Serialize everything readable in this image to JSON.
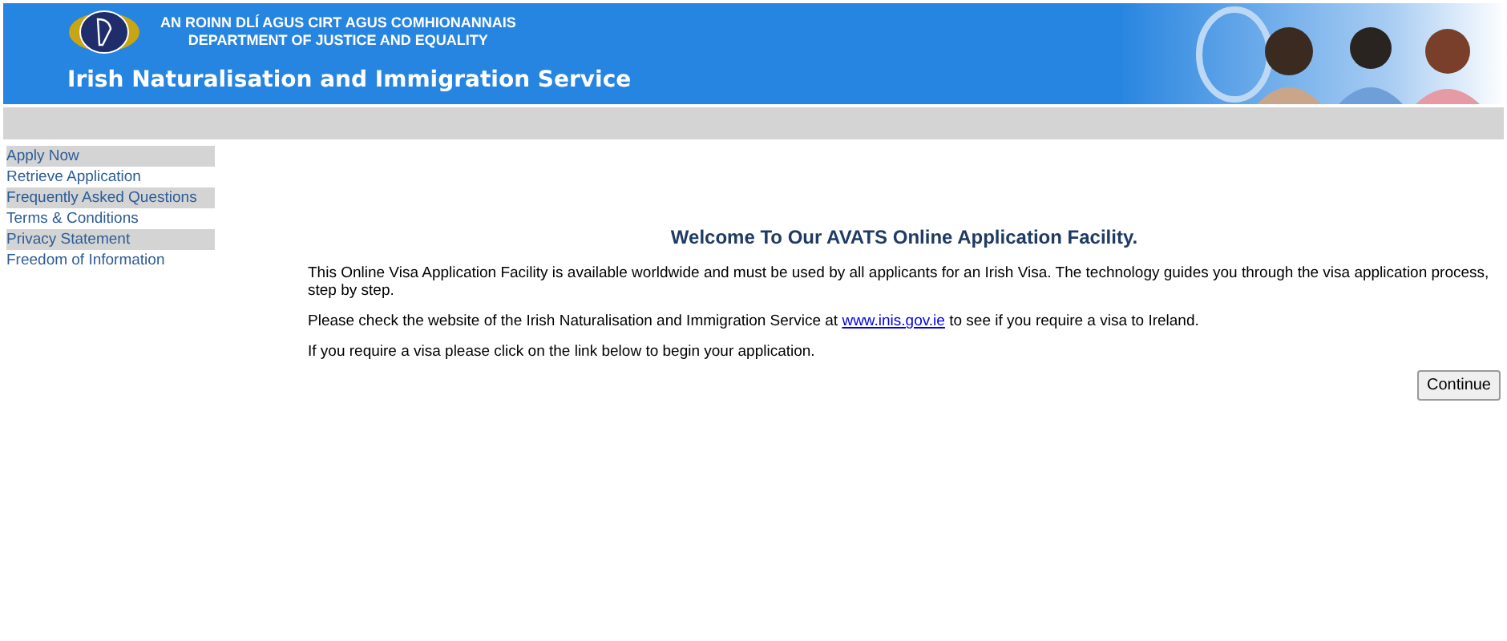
{
  "header": {
    "irish_title": "AN ROINN DLÍ AGUS CIRT AGUS COMHIONANNAIS",
    "english_title": "DEPARTMENT OF JUSTICE AND EQUALITY",
    "service_name": "Irish Naturalisation and Immigration Service"
  },
  "sidebar": {
    "items": [
      {
        "label": "Apply Now"
      },
      {
        "label": "Retrieve Application"
      },
      {
        "label": "Frequently Asked Questions"
      },
      {
        "label": "Terms & Conditions"
      },
      {
        "label": "Privacy Statement"
      },
      {
        "label": "Freedom of Information"
      }
    ]
  },
  "main": {
    "heading": "Welcome To Our AVATS Online Application Facility.",
    "intro": "This Online Visa Application Facility is available worldwide and must be used by all applicants for an Irish Visa. The technology guides you through the visa application process, step by step.",
    "check_before": "Please check the website of the Irish Naturalisation and Immigration Service at",
    "check_link": "www.inis.gov.ie",
    "check_after": "to see if you require a visa to Ireland.",
    "instruction": "If you require a visa please click on the link below to begin your application.",
    "continue_button": "Continue"
  }
}
